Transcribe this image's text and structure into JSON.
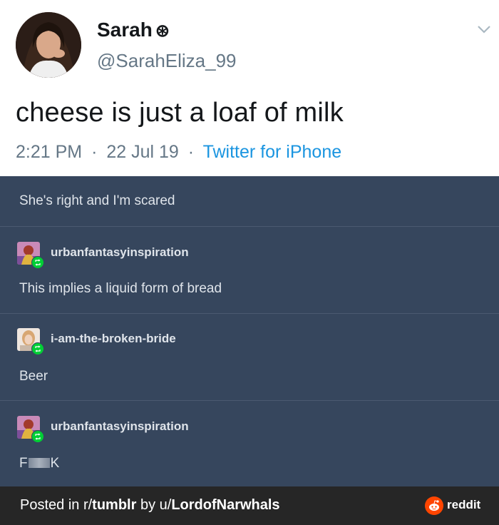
{
  "tweet": {
    "name": "Sarah",
    "badge": "⊛",
    "handle": "@SarahEliza_99",
    "text": "cheese is just a loaf of milk",
    "time": "2:21 PM",
    "sep": "·",
    "date": "22 Jul 19",
    "source": "Twitter for iPhone"
  },
  "thread": {
    "intro": "She's right and I'm scared",
    "posts": [
      {
        "username": "urbanfantasyinspiration",
        "text": "This implies a liquid form of bread"
      },
      {
        "username": "i-am-the-broken-bride",
        "text": "Beer"
      },
      {
        "username": "urbanfantasyinspiration",
        "text_start": "F",
        "text_end": "K"
      }
    ]
  },
  "footer": {
    "posted_in": "Posted in r/",
    "subreddit": "tumblr",
    "by": " by u/",
    "user": "LordofNarwhals",
    "brand": "reddit"
  },
  "colors": {
    "tumblr_bg": "#36465d",
    "twitter_link": "#1b95e0",
    "reblog_green": "#00cf35",
    "reddit_orange": "#ff4500",
    "footer_bg": "#262626"
  }
}
